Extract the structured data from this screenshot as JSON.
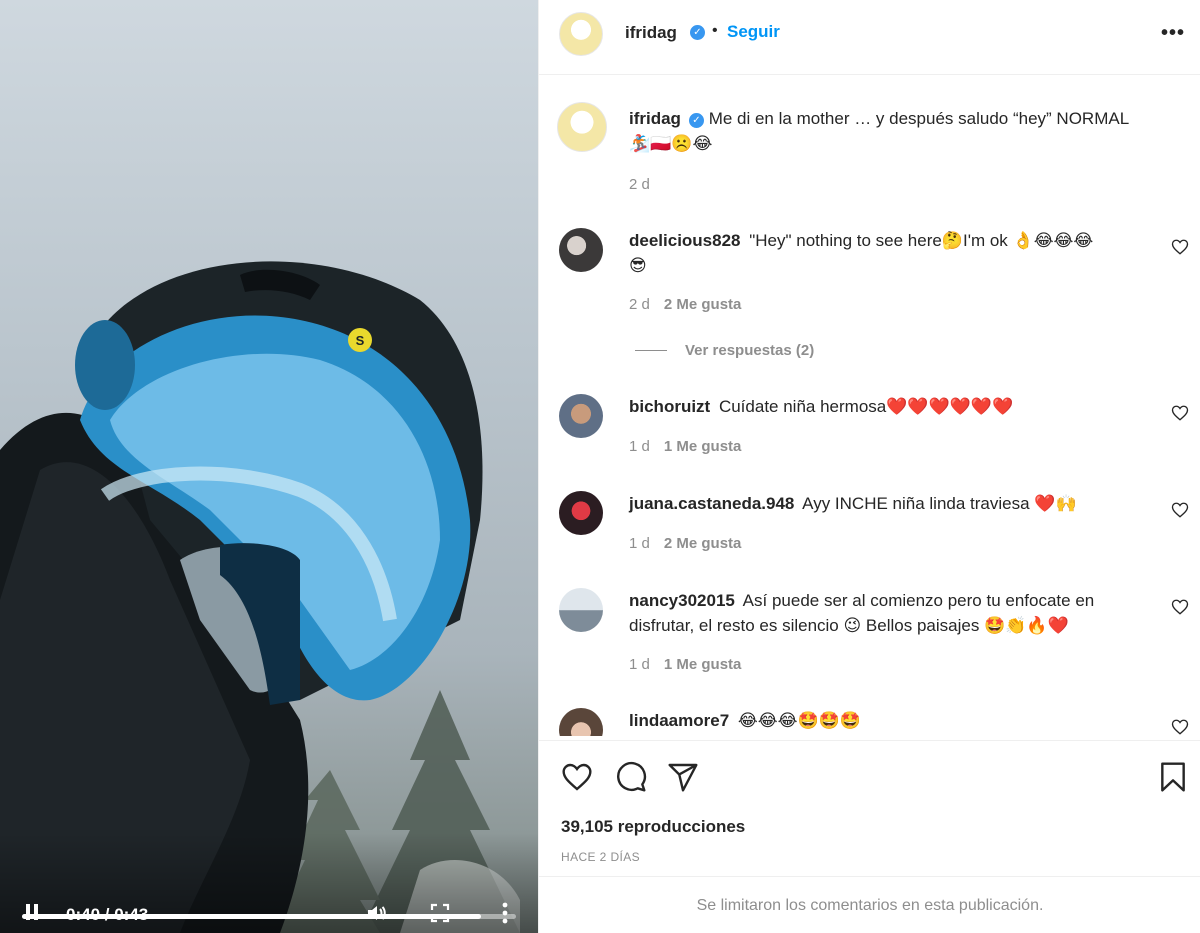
{
  "post": {
    "username": "ifridag",
    "follow_label": "Seguir",
    "more_label": "•••",
    "verified_mark": "✓"
  },
  "video": {
    "time_display": "0:40 / 0:43",
    "progress": 0.93,
    "helmet_brand": "S"
  },
  "caption": {
    "username": "ifridag",
    "text": "Me di en la mother … y después saludo “hey” NORMAL",
    "emojis": "🏂🇵🇱☹️😂",
    "age": "2 d"
  },
  "comments": [
    {
      "username": "deelicious828",
      "text": "\"Hey\" nothing to see here🤔I'm ok 👌😂😂😂",
      "text2": "😎",
      "age": "2 d",
      "likes": "2 Me gusta",
      "replies": "Ver respuestas (2)"
    },
    {
      "username": "bichoruizt",
      "text": "Cuídate niña hermosa❤️❤️❤️❤️❤️❤️",
      "age": "1 d",
      "likes": "1 Me gusta"
    },
    {
      "username": "juana.castaneda.948",
      "text": "Ayy INCHE niña linda traviesa ❤️🙌",
      "age": "1 d",
      "likes": "2 Me gusta"
    },
    {
      "username": "nancy302015",
      "text": "Así puede ser al comienzo pero tu enfocate en",
      "text2": "disfrutar, el resto es silencio 😉 Bellos paisajes 🤩👏🔥❤️",
      "age": "1 d",
      "likes": "1 Me gusta"
    },
    {
      "username": "lindaamore7",
      "text": "😂😂😂🤩🤩🤩"
    }
  ],
  "stats": {
    "views": "39,105 reproducciones",
    "posted": "HACE 2 DÍAS"
  },
  "footer": {
    "limited": "Se limitaron los comentarios en esta publicación."
  },
  "colors": {
    "accent": "#0095f6",
    "verified": "#3897f0",
    "muted": "#8e8e8e",
    "text": "#262626"
  }
}
